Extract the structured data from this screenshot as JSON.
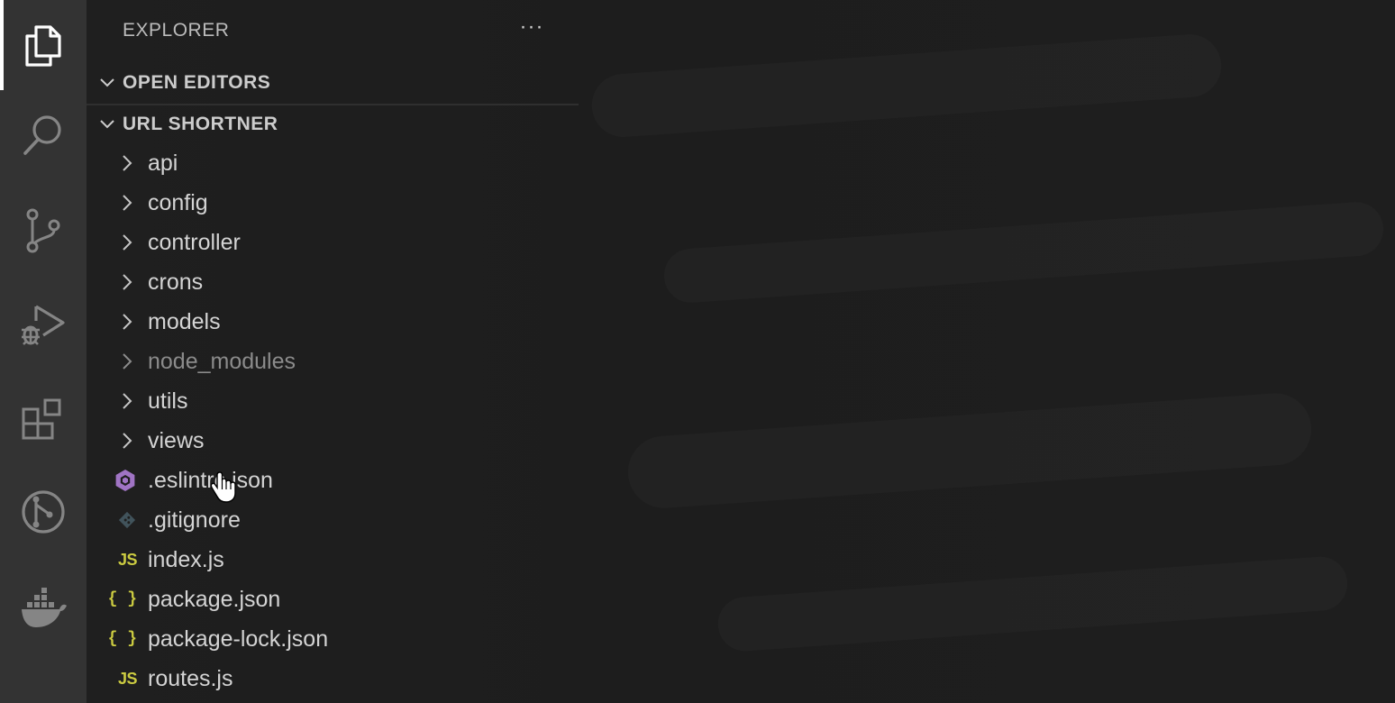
{
  "explorer": {
    "title": "EXPLORER",
    "more_label": "···"
  },
  "sections": {
    "open_editors": "OPEN EDITORS",
    "project": "URL SHORTNER"
  },
  "folders": [
    {
      "name": "api"
    },
    {
      "name": "config"
    },
    {
      "name": "controller"
    },
    {
      "name": "crons"
    },
    {
      "name": "models"
    },
    {
      "name": "node_modules",
      "dimmed": true
    },
    {
      "name": "utils"
    },
    {
      "name": "views"
    }
  ],
  "files": [
    {
      "name": ".eslintrc.json",
      "icon": "eslint-icon"
    },
    {
      "name": ".gitignore",
      "icon": "git-icon"
    },
    {
      "name": "index.js",
      "icon": "js-icon",
      "icon_text": "JS"
    },
    {
      "name": "package.json",
      "icon": "json-icon",
      "icon_text": "{ }"
    },
    {
      "name": "package-lock.json",
      "icon": "json-icon",
      "icon_text": "{ }"
    },
    {
      "name": "routes.js",
      "icon": "js-icon",
      "icon_text": "JS"
    }
  ],
  "activity_bar": [
    {
      "icon": "files-icon",
      "active": true
    },
    {
      "icon": "search-icon"
    },
    {
      "icon": "source-control-icon"
    },
    {
      "icon": "run-debug-icon"
    },
    {
      "icon": "extensions-icon"
    },
    {
      "icon": "git-graph-icon"
    },
    {
      "icon": "docker-icon"
    }
  ],
  "colors": {
    "activity_bar_bg": "#333333",
    "sidebar_bg": "#1e1e1e",
    "text": "#d4d4d4",
    "dim_text": "#8b8b8b",
    "js_yellow": "#cbcb41",
    "eslint_purple": "#a074c4",
    "git_slate": "#41535b"
  }
}
